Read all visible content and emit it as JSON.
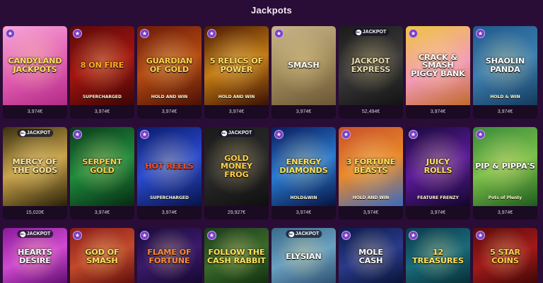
{
  "page": {
    "title": "Jackpots"
  },
  "colors": {
    "background": "#2a0d36",
    "badge": "#7a3fc4"
  },
  "games": [
    {
      "name": "Candyland\nJackpots",
      "sub": "",
      "price": "3,974€",
      "badge": "star",
      "bg": "linear-gradient(160deg,#f7a6d8,#e05bb0 55%,#b12a86)",
      "color": "#ffe35a"
    },
    {
      "name": "8 On Fire",
      "sub": "SUPERCHARGED",
      "price": "3,974€",
      "badge": "star",
      "bg": "linear-gradient(160deg,#5a0a0a,#a3140f 50%,#3b0505)",
      "color": "#ffb020"
    },
    {
      "name": "Guardian\nof Gold",
      "sub": "HOLD AND WIN",
      "price": "3,974€",
      "badge": "star",
      "bg": "linear-gradient(160deg,#6b1a0a,#b34a12 50%,#4a1005)",
      "color": "#ffd24a"
    },
    {
      "name": "5 Relics of Power",
      "sub": "HOLD AND WIN",
      "price": "3,974€",
      "badge": "star",
      "bg": "linear-gradient(160deg,#4a1a05,#c27a12 50%,#3a1005)",
      "color": "#ffe06a"
    },
    {
      "name": "Smash",
      "sub": "",
      "price": "3,974€",
      "badge": "star",
      "bg": "linear-gradient(160deg,#c9b58a,#9f8a5c 50%,#6b5636)",
      "color": "#ffffff"
    },
    {
      "name": "Jackpot\nExpress",
      "sub": "",
      "price": "52,494€",
      "badge": "jackpot",
      "bg": "linear-gradient(160deg,#1a1a1a,#3a3a3a 50%,#121212)",
      "color": "#e8d9b0"
    },
    {
      "name": "Crack & Smash\nPiggy Bank",
      "sub": "",
      "price": "3,974€",
      "badge": "star",
      "bg": "linear-gradient(160deg,#f0c640,#f29ab8 55%,#c06a2a)",
      "color": "#ffffff"
    },
    {
      "name": "Shaolin\nPanda",
      "sub": "HOLD & WIN",
      "price": "3,974€",
      "badge": "star",
      "bg": "linear-gradient(160deg,#1f5a8c,#3d7fb0 50%,#143a5c)",
      "color": "#ffffff"
    },
    {
      "name": "Mercy of\nthe Gods",
      "sub": "",
      "price": "15,020€",
      "badge": "jackpot-dual",
      "bg": "linear-gradient(160deg,#3a3010,#c7a24a 50%,#2a2008)",
      "color": "#ffe7a0"
    },
    {
      "name": "Serpent\nGold",
      "sub": "",
      "price": "3,974€",
      "badge": "star",
      "bg": "linear-gradient(160deg,#0a3a1a,#1f8a3c 50%,#062a12)",
      "color": "#ffd24a"
    },
    {
      "name": "Hot Reels",
      "sub": "SUPERCHARGED",
      "price": "3,974€",
      "badge": "star",
      "bg": "linear-gradient(160deg,#0a1a6b,#2a4bd0 50%,#071248)",
      "color": "#ff4a2a"
    },
    {
      "name": "Gold\nMoney\nFrog",
      "sub": "",
      "price": "29,927€",
      "badge": "jackpot",
      "bg": "linear-gradient(160deg,#1a1a1a,#2a2a2a 50%,#0e0e0e)",
      "color": "#ffd24a"
    },
    {
      "name": "Energy\nDiamonds",
      "sub": "HOLD&WIN",
      "price": "3,974€",
      "badge": "star",
      "bg": "linear-gradient(160deg,#0a1a5a,#2a7ad0 50%,#061240)",
      "color": "#ffe35a"
    },
    {
      "name": "3 Fortune\nBeasts",
      "sub": "HOLD AND WIN",
      "price": "3,974€",
      "badge": "star",
      "bg": "linear-gradient(160deg,#c9502a,#e8882a 50%,#3a6ac0)",
      "color": "#ffe35a"
    },
    {
      "name": "Juicy\nRolls",
      "sub": "FEATURE FRENZY",
      "price": "3,974€",
      "badge": "star",
      "bg": "linear-gradient(160deg,#1a0a3a,#5a1a9a 50%,#12062a)",
      "color": "#ffe35a"
    },
    {
      "name": "Pip & Pippa's",
      "sub": "Pots of Plenty",
      "price": "3,974€",
      "badge": "star",
      "bg": "linear-gradient(160deg,#3a8a3a,#7ac04a 50%,#1f5a1f)",
      "color": "#ffffff"
    },
    {
      "name": "Hearts\nDesire",
      "sub": "",
      "price": "",
      "badge": "jackpot",
      "bg": "linear-gradient(160deg,#8a1a9a,#d04ad0 50%,#5a0a6a)",
      "color": "#ffffff"
    },
    {
      "name": "God of\nSmash",
      "sub": "",
      "price": "",
      "badge": "star",
      "bg": "linear-gradient(160deg,#8a1a1a,#c04a2a 50%,#5a0a0a)",
      "color": "#ffe35a"
    },
    {
      "name": "Flame of\nFortune",
      "sub": "",
      "price": "",
      "badge": "star",
      "bg": "linear-gradient(160deg,#1a0a3a,#3a1a6a 50%,#12062a)",
      "color": "#ff8a3a"
    },
    {
      "name": "Follow the\nCash Rabbit",
      "sub": "",
      "price": "",
      "badge": "star",
      "bg": "linear-gradient(160deg,#1a3a1a,#3a6a2a 50%,#0e2a0e)",
      "color": "#ffe35a"
    },
    {
      "name": "Elysian",
      "sub": "",
      "price": "",
      "badge": "jackpot",
      "bg": "linear-gradient(160deg,#3a6a8a,#6aa0c0 50%,#2a4a6a)",
      "color": "#ffffff"
    },
    {
      "name": "Mole\nCash",
      "sub": "",
      "price": "",
      "badge": "star",
      "bg": "linear-gradient(160deg,#0a1a4a,#2a3a8a 50%,#061030)",
      "color": "#ffffff"
    },
    {
      "name": "12\nTreasures",
      "sub": "",
      "price": "",
      "badge": "star",
      "bg": "linear-gradient(160deg,#0a3a4a,#1a6a7a 50%,#062a30)",
      "color": "#ffe35a"
    },
    {
      "name": "5 Star\nCoins",
      "sub": "",
      "price": "",
      "badge": "star",
      "bg": "linear-gradient(160deg,#5a0a0a,#a01a1a 50%,#3a0505)",
      "color": "#ffd24a"
    }
  ]
}
